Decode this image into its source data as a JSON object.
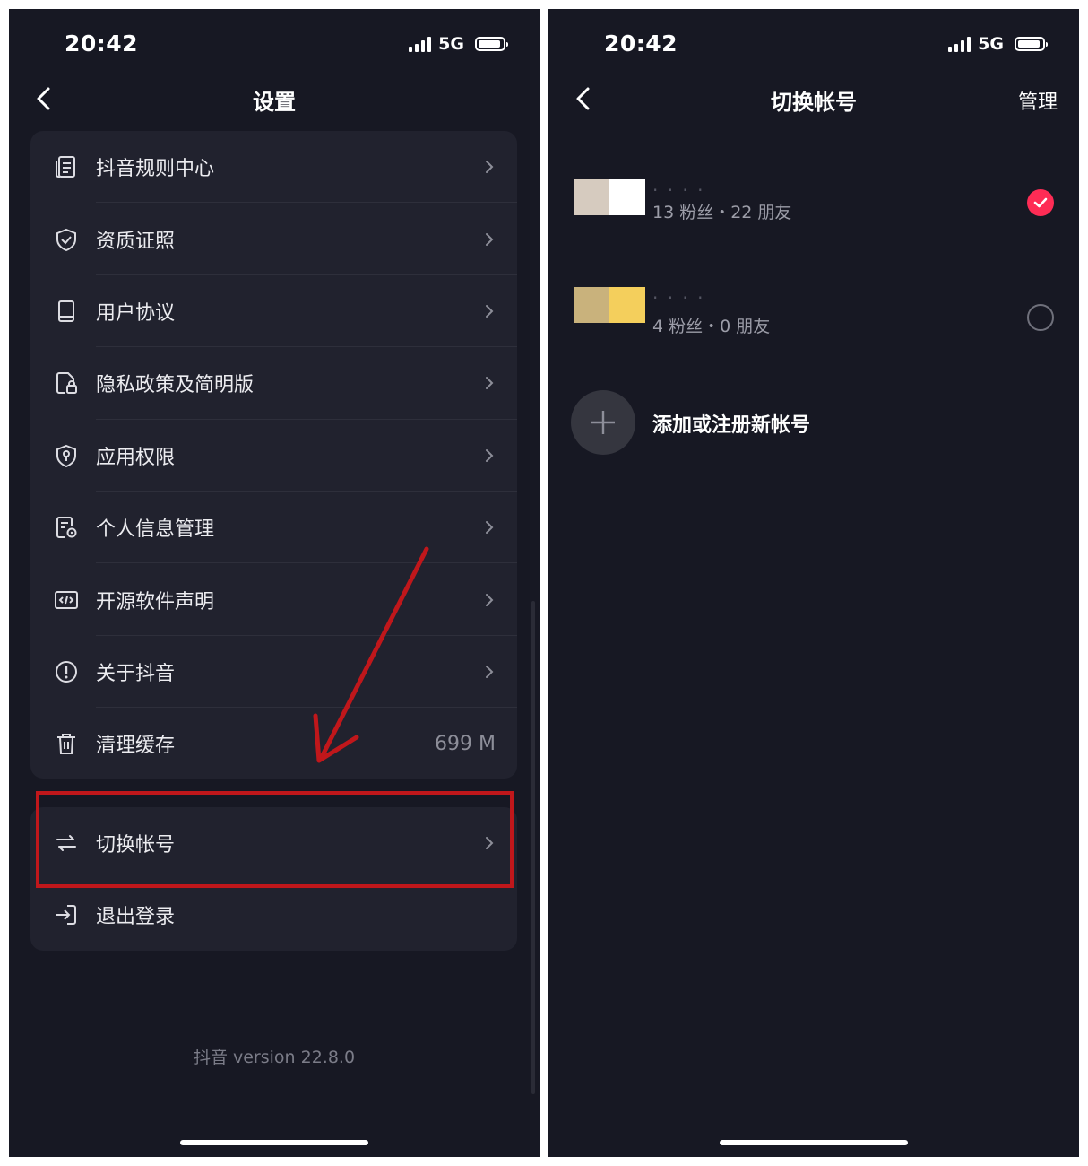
{
  "left": {
    "status": {
      "time": "20:42",
      "network": "5G"
    },
    "nav": {
      "title": "设置"
    },
    "menu": [
      {
        "label": "抖音规则中心",
        "icon": "document-list-icon"
      },
      {
        "label": "资质证照",
        "icon": "shield-check-icon"
      },
      {
        "label": "用户协议",
        "icon": "book-icon"
      },
      {
        "label": "隐私政策及简明版",
        "icon": "file-lock-icon"
      },
      {
        "label": "应用权限",
        "icon": "shield-location-icon"
      },
      {
        "label": "个人信息管理",
        "icon": "file-settings-icon"
      },
      {
        "label": "开源软件声明",
        "icon": "code-icon"
      },
      {
        "label": "关于抖音",
        "icon": "info-exclaim-icon"
      },
      {
        "label": "清理缓存",
        "icon": "trash-icon",
        "value": "699 M"
      }
    ],
    "account_menu": [
      {
        "label": "切换帐号",
        "icon": "switch-arrows-icon"
      },
      {
        "label": "退出登录",
        "icon": "logout-icon"
      }
    ],
    "version": "抖音 version 22.8.0"
  },
  "right": {
    "status": {
      "time": "20:42",
      "network": "5G"
    },
    "nav": {
      "title": "切换帐号",
      "action": "管理"
    },
    "accounts": [
      {
        "name": "· · · ·",
        "stats": "13 粉丝・22 朋友",
        "selected": true,
        "avatar_colors": [
          "#d6cbbf",
          "#ffffff"
        ]
      },
      {
        "name": "· · · ·",
        "stats": "4 粉丝・0 朋友",
        "selected": false,
        "avatar_colors": [
          "#c9b27c",
          "#f4cf5c"
        ]
      }
    ],
    "add_label": "添加或注册新帐号"
  },
  "colors": {
    "background": "#171823",
    "card": "#21222e",
    "accent_red": "#fe2c55",
    "highlight_box": "#c0171b",
    "arrow": "#c0171b"
  }
}
